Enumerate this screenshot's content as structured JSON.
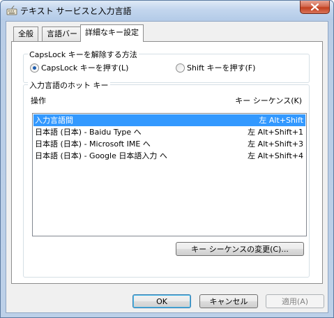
{
  "window": {
    "title": "テキスト サービスと入力言語"
  },
  "tabs": [
    {
      "label": "全般"
    },
    {
      "label": "言語バー"
    },
    {
      "label": "詳細なキー設定"
    }
  ],
  "capslock_group": {
    "label": "CapsLock キーを解除する方法",
    "options": [
      {
        "label": "CapsLock キーを押す(L)",
        "checked": true
      },
      {
        "label": "Shift キーを押す(F)",
        "checked": false
      }
    ]
  },
  "hotkeys_group": {
    "label": "入力言語のホット キー",
    "col_action": "操作",
    "col_keys": "キー シーケンス(K)",
    "rows": [
      {
        "name": "入力言語間",
        "keys": "左 Alt+Shift",
        "selected": true
      },
      {
        "name": "日本語 (日本) - Baidu Type へ",
        "keys": "左 Alt+Shift+1",
        "selected": false
      },
      {
        "name": "日本語 (日本) - Microsoft IME へ",
        "keys": "左 Alt+Shift+3",
        "selected": false
      },
      {
        "name": "日本語 (日本) - Google 日本語入力 へ",
        "keys": "左 Alt+Shift+4",
        "selected": false
      }
    ],
    "change_button": "キー シーケンスの変更(C)..."
  },
  "footer": {
    "ok": "OK",
    "cancel": "キャンセル",
    "apply": "適用(A)"
  },
  "colors": {
    "selection": "#3399ff",
    "close_button": "#c2401f"
  }
}
